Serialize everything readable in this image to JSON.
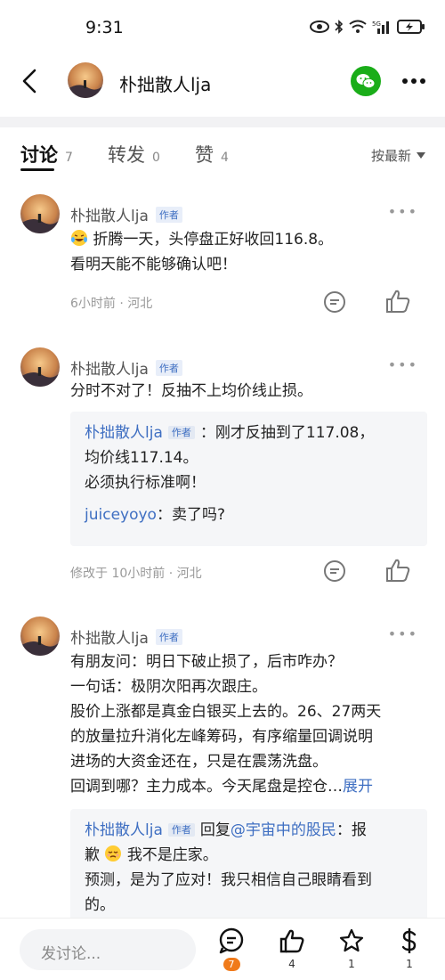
{
  "status_bar": {
    "time": "9:31"
  },
  "header": {
    "title": "朴拙散人lja"
  },
  "tabs": [
    {
      "label": "讨论",
      "count": "7"
    },
    {
      "label": "转发",
      "count": "0"
    },
    {
      "label": "赞",
      "count": "4"
    }
  ],
  "sort_label": "按最新",
  "comments": [
    {
      "author": "朴拙散人lja",
      "badge": "作者",
      "lines": [
        "折腾一天，头停盘正好收回116.8。",
        "看明天能不能够确认吧！"
      ],
      "meta": "6小时前 · 河北"
    },
    {
      "author": "朴拙散人lja",
      "badge": "作者",
      "lines": [
        "分时不对了！反抽不上均价线止损。"
      ],
      "quotes": [
        {
          "name": "朴拙散人lja",
          "badge": "作者",
          "sep": "：",
          "text1": "刚才反抽到了117.08，",
          "text2": "均价线117.14。",
          "text3": "必须执行标准啊！"
        },
        {
          "name": "juiceyoyo",
          "sep": "：",
          "text1": "卖了吗?"
        }
      ],
      "meta": "修改于 10小时前 · 河北"
    },
    {
      "author": "朴拙散人lja",
      "badge": "作者",
      "lines": [
        "有朋友问：明日下破止损了，后市咋办？",
        "一句话：极阴次阳再次跟庄。",
        "股价上涨都是真金白银买上去的。26、27两天",
        "的放量拉升消化左峰筹码，有序缩量回调说明",
        "进场的大资金还在，只是在震荡洗盘。",
        "回调到哪？主力成本。今天尾盘是控仓…"
      ],
      "expand": "展开",
      "quote": {
        "name": "朴拙散人lja",
        "badge": "作者",
        "reply_prefix": "回复",
        "reply_to": "@宇宙中的股民",
        "sep": "：",
        "line1_end": "报",
        "line2a": "歉",
        "line2b": "我不是庄家。",
        "line3": "预测，是为了应对！我只相信自己眼睛看到",
        "line4": "的。"
      }
    }
  ],
  "bottom": {
    "input_placeholder": "发讨论...",
    "comment_count": "7",
    "like_count": "4",
    "star_count": "1",
    "reward_count": "1"
  },
  "colors": {
    "accent_blue": "#3f6fc2",
    "badge_orange": "#f07a1a",
    "wechat_green": "#1aad19"
  }
}
